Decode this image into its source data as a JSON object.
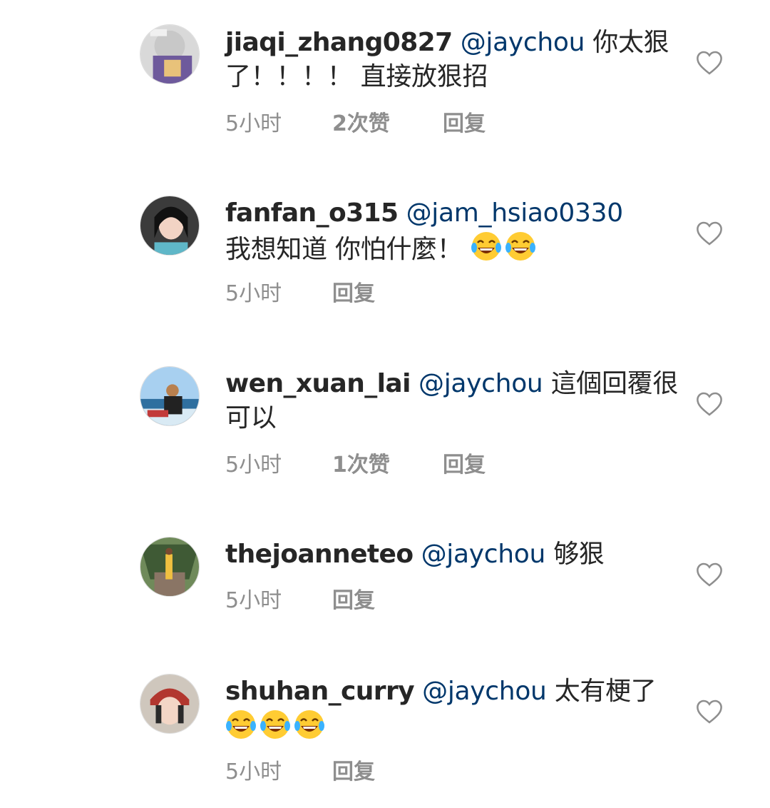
{
  "comments": [
    {
      "username": "jiaqi_zhang0827",
      "mention": "@jaychou",
      "text": " 你太狠了！！！！ 直接放狠招",
      "time": "5小时",
      "likes": "2次赞",
      "reply": "回复"
    },
    {
      "username": "fanfan_o315",
      "mention": "@jam_hsiao0330",
      "text": "我想知道 你怕什麼！",
      "emoji_count": 2,
      "time": "5小时",
      "reply": "回复"
    },
    {
      "username": "wen_xuan_lai",
      "mention": "@jaychou",
      "text": " 這個回覆很可以",
      "time": "5小时",
      "likes": "1次赞",
      "reply": "回复"
    },
    {
      "username": "thejoanneteo",
      "mention": "@jaychou",
      "text": " 够狠",
      "time": "5小时",
      "reply": "回复"
    },
    {
      "username": "shuhan_curry",
      "mention": "@jaychou",
      "text": " 太有梗了",
      "emoji_count": 3,
      "time": "5小时",
      "reply": "回复"
    }
  ],
  "icons": {
    "like": "heart-outline-icon",
    "emoji": "face-with-tears-of-joy-emoji"
  },
  "colors": {
    "username": "#262626",
    "mention": "#00376b",
    "meta": "#8e8e8e",
    "heart": "#8e8e8e"
  }
}
